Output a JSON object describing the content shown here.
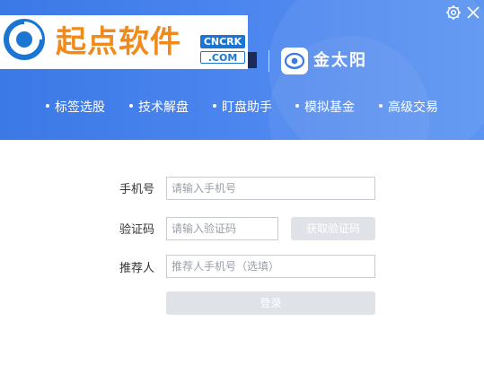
{
  "watermark": {
    "text": "起点软件",
    "badge_top": "CNCRK",
    "badge_bottom": ".COM"
  },
  "header": {
    "partner_name": "金太阳"
  },
  "window_controls": {
    "settings_icon": "gear-icon",
    "close_icon": "close-icon"
  },
  "nav": {
    "items": [
      {
        "label": "标签选股"
      },
      {
        "label": "技术解盘"
      },
      {
        "label": "盯盘助手"
      },
      {
        "label": "模拟基金"
      },
      {
        "label": "高级交易"
      }
    ]
  },
  "form": {
    "phone_label": "手机号",
    "phone_placeholder": "请输入手机号",
    "code_label": "验证码",
    "code_placeholder": "请输入验证码",
    "get_code_button": "获取验证码",
    "referrer_label": "推荐人",
    "referrer_placeholder": "推荐人手机号（选填）",
    "login_button": "登录"
  },
  "colors": {
    "header_blue": "#4a84ee",
    "button_disabled": "#dfe2e7",
    "watermark_orange": "#f08a1c",
    "watermark_blue": "#1a76d2"
  }
}
